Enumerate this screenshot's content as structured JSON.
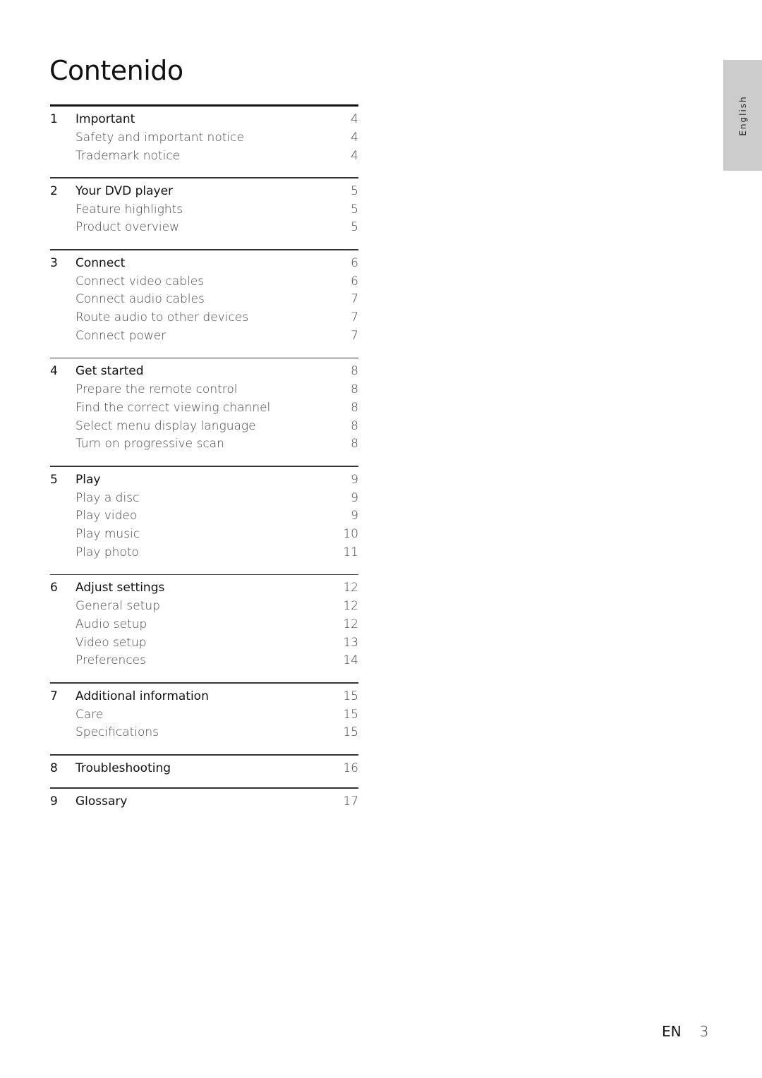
{
  "page": {
    "title": "Contenido",
    "language_tab": "English",
    "footer": {
      "lang_code": "EN",
      "page_number": "3"
    }
  },
  "toc": [
    {
      "num": "1",
      "title": "Important",
      "page": "4",
      "items": [
        {
          "title": "Safety and important notice",
          "page": "4"
        },
        {
          "title": "Trademark notice",
          "page": "4"
        }
      ]
    },
    {
      "num": "2",
      "title": "Your DVD player",
      "page": "5",
      "items": [
        {
          "title": "Feature highlights",
          "page": "5"
        },
        {
          "title": "Product overview",
          "page": "5"
        }
      ]
    },
    {
      "num": "3",
      "title": "Connect",
      "page": "6",
      "items": [
        {
          "title": "Connect video cables",
          "page": "6"
        },
        {
          "title": "Connect audio cables",
          "page": "7"
        },
        {
          "title": "Route audio to other devices",
          "page": "7"
        },
        {
          "title": "Connect power",
          "page": "7"
        }
      ]
    },
    {
      "num": "4",
      "title": "Get started",
      "page": "8",
      "items": [
        {
          "title": "Prepare the remote control",
          "page": "8"
        },
        {
          "title": "Find the correct viewing channel",
          "page": "8"
        },
        {
          "title": "Select menu display language",
          "page": "8"
        },
        {
          "title": "Turn on progressive scan",
          "page": "8"
        }
      ]
    },
    {
      "num": "5",
      "title": "Play",
      "page": "9",
      "items": [
        {
          "title": "Play a disc",
          "page": "9"
        },
        {
          "title": "Play video",
          "page": "9"
        },
        {
          "title": "Play music",
          "page": "10"
        },
        {
          "title": "Play photo",
          "page": "11"
        }
      ]
    },
    {
      "num": "6",
      "title": "Adjust settings",
      "page": "12",
      "items": [
        {
          "title": "General setup",
          "page": "12"
        },
        {
          "title": "Audio setup",
          "page": "12"
        },
        {
          "title": "Video setup",
          "page": "13"
        },
        {
          "title": "Preferences",
          "page": "14"
        }
      ]
    },
    {
      "num": "7",
      "title": "Additional information",
      "page": "15",
      "items": [
        {
          "title": "Care",
          "page": "15"
        },
        {
          "title": "Specifications",
          "page": "15"
        }
      ]
    },
    {
      "num": "8",
      "title": "Troubleshooting",
      "page": "16",
      "items": []
    },
    {
      "num": "9",
      "title": "Glossary",
      "page": "17",
      "items": []
    }
  ]
}
